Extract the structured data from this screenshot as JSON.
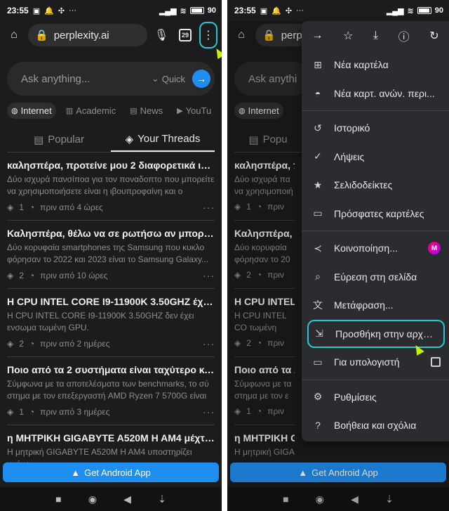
{
  "status": {
    "time": "23:55",
    "battery": "90"
  },
  "urlbar": {
    "url": "perplexity.ai",
    "url_partial": "perple",
    "tab_count": "29"
  },
  "search": {
    "placeholder": "Ask anything...",
    "placeholder_partial": "Ask anythi",
    "mode": "Quick"
  },
  "filters": [
    "Internet",
    "Academic",
    "News",
    "YouTu"
  ],
  "tabs": {
    "popular": "Popular",
    "popular_partial": "Popu",
    "threads": "Your Threads"
  },
  "threads": [
    {
      "title": "καλησπέρα, προτείνε μου 2 διαφορετικά ισχυρ...",
      "desc": "Δύο ισχυρά πανσίποα για τον ποναδοπτο που μπορείτε να χρησιμοποιήσετε είναι η ιβουπροφαίνη και ο ασπιρί...",
      "count": "1",
      "time": "πριν από 4 ώρες",
      "title_partial": "καλησπέρα, προτ",
      "desc_partial": "Δύο ισχυρά πα να χρησιμοποιή",
      "time_partial": "πριν"
    },
    {
      "title": "Καλησπέρα, θέλω να σε ρωτήσω αν μπορείς να ...",
      "desc": "Δύο κορυφαία smartphones της Samsung που κυκλο φόρησαν το 2022 και 2023 είναι το Samsung Galaxy...",
      "count": "2",
      "time": "πριν από 10 ώρες",
      "title_partial": "Καλησπέρα, θέλω",
      "desc_partial": "Δύο κορυφαία φόρησαν το 20",
      "time_partial": "πριν"
    },
    {
      "title": "H CPU INTEL CORE I9-11900K 3.50GHZ έχει εν...",
      "desc": "H CPU INTEL CORE I9-11900K 3.50GHZ δεν έχει ενσωμα τωμένη GPU.",
      "count": "2",
      "time": "πριν από 2 ημέρες",
      "title_partial": "H CPU INTEL CORE",
      "desc_partial": "H CPU INTEL CO τωμένη GPU.",
      "time_partial": "πριν"
    },
    {
      "title": "Ποιο από τα 2 συστήματα είναι ταχύτερο και θα...",
      "desc": "Σύμφωνα με τα αποτελέσματα των benchmarks, το σύ στημα με τον επεξεργαστή AMD Ryzen 7 5700G είναι ...",
      "count": "1",
      "time": "πριν από 3 ημέρες",
      "title_partial": "Ποιο από τα 2 σ",
      "desc_partial": "Σύμφωνα με τα στημα με τον ε",
      "time_partial": "πριν"
    },
    {
      "title": "η ΜΗΤΡΙΚΗ GIGABYTE A520M H AM4 μέχτι πό...",
      "desc": "Η μητρική GIGABYTE A520M H AM4 υποστηρίζει μνήμε",
      "count": "",
      "time": "",
      "title_partial": "η ΜΗΤΡΙΚΗ GIGA",
      "desc_partial": "Η μητρική GIGA",
      "time_partial": ""
    }
  ],
  "android_button": "Get Android App",
  "menu": {
    "items": [
      {
        "icon": "plus-square-icon",
        "label": "Νέα καρτέλα"
      },
      {
        "icon": "incognito-icon",
        "label": "Νέα καρτ. ανών. περι..."
      },
      {
        "icon": "history-icon",
        "label": "Ιστορικό"
      },
      {
        "icon": "downloads-icon",
        "label": "Λήψεις"
      },
      {
        "icon": "star-icon",
        "label": "Σελιδοδείκτες"
      },
      {
        "icon": "devices-icon",
        "label": "Πρόσφατες καρτέλες"
      },
      {
        "icon": "share-icon",
        "label": "Κοινοποίηση..."
      },
      {
        "icon": "find-icon",
        "label": "Εύρεση στη σελίδα"
      },
      {
        "icon": "translate-icon",
        "label": "Μετάφραση..."
      },
      {
        "icon": "add-home-icon",
        "label": "Προσθήκη στην αρχική..."
      },
      {
        "icon": "desktop-icon",
        "label": "Για υπολογιστή"
      },
      {
        "icon": "settings-icon",
        "label": "Ρυθμίσεις"
      },
      {
        "icon": "help-icon",
        "label": "Βοήθεια και σχόλια"
      }
    ]
  }
}
